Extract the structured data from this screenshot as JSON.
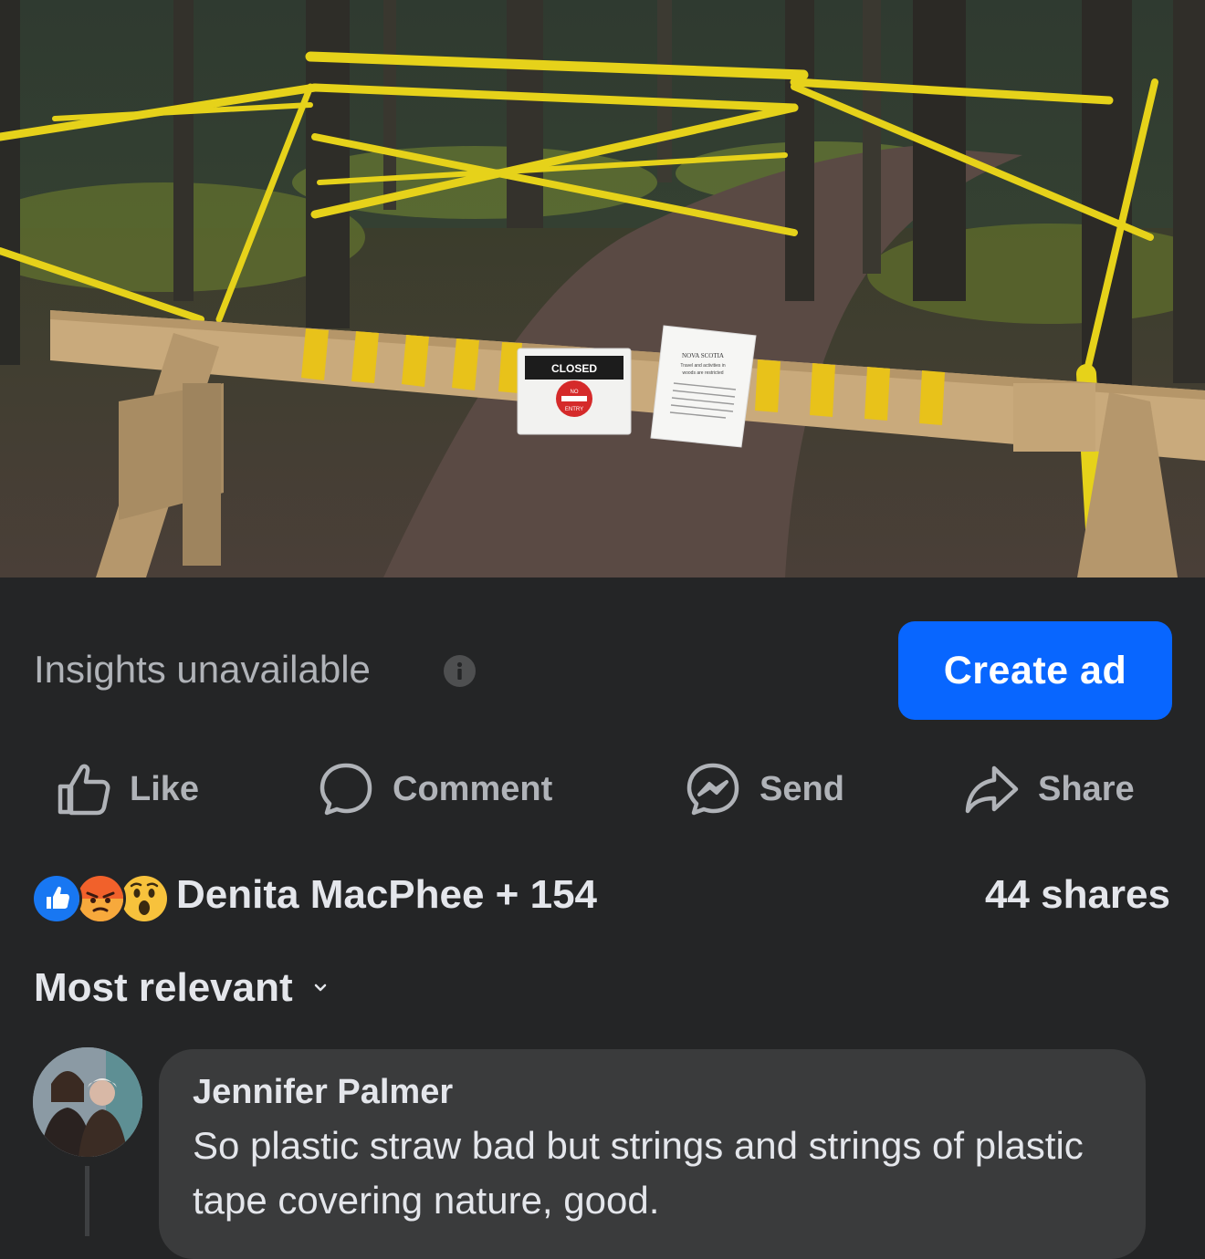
{
  "post": {
    "image_alt": "Wooded trail blocked by a sawhorse barricade with yellow caution tape and posted closure signs",
    "signs": {
      "closed_sign": {
        "header": "CLOSED",
        "icon_text_1": "NO",
        "icon_text_2": "ENTRY"
      },
      "nova_scotia_sign": {
        "title": "NOVA SCOTIA",
        "line1": "Travel and activities in",
        "line2": "woods are restricted"
      }
    }
  },
  "insights": {
    "label": "Insights unavailable",
    "info_icon": "info-icon",
    "create_ad_label": "Create ad"
  },
  "actions": [
    {
      "label": "Like",
      "icon": "thumbs-up-icon"
    },
    {
      "label": "Comment",
      "icon": "comment-icon"
    },
    {
      "label": "Send",
      "icon": "messenger-icon"
    },
    {
      "label": "Share",
      "icon": "share-arrow-icon"
    }
  ],
  "reactions": {
    "icons": [
      "like-reaction-icon",
      "angry-reaction-icon",
      "wow-reaction-icon"
    ],
    "summary": "Denita MacPhee + 154",
    "shares": "44 shares"
  },
  "comments_sort": {
    "label": "Most relevant",
    "icon": "chevron-down-icon"
  },
  "comments": [
    {
      "author": "Jennifer Palmer",
      "text": "So plastic straw bad but strings and strings of plastic tape covering nature, good."
    }
  ],
  "colors": {
    "background": "#242526",
    "bubble": "#3a3b3c",
    "primary_button": "#0866ff",
    "secondary_text": "#b0b3b8",
    "primary_text": "#e4e6eb",
    "caution_yellow": "#e6d21a"
  }
}
